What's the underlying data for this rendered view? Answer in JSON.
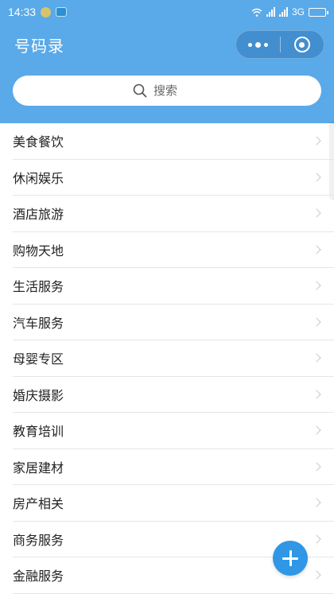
{
  "status_bar": {
    "time": "14:33",
    "network": "3G",
    "battery_level": 0.85
  },
  "header": {
    "title": "号码录",
    "background_color": "#5aa9e8"
  },
  "search": {
    "placeholder": "搜索"
  },
  "categories": [
    "美食餐饮",
    "休闲娱乐",
    "酒店旅游",
    "购物天地",
    "生活服务",
    "汽车服务",
    "母婴专区",
    "婚庆摄影",
    "教育培训",
    "家居建材",
    "房产相关",
    "商务服务",
    "金融服务"
  ],
  "fab": {
    "icon": "plus-icon",
    "color": "#2f97e5"
  }
}
